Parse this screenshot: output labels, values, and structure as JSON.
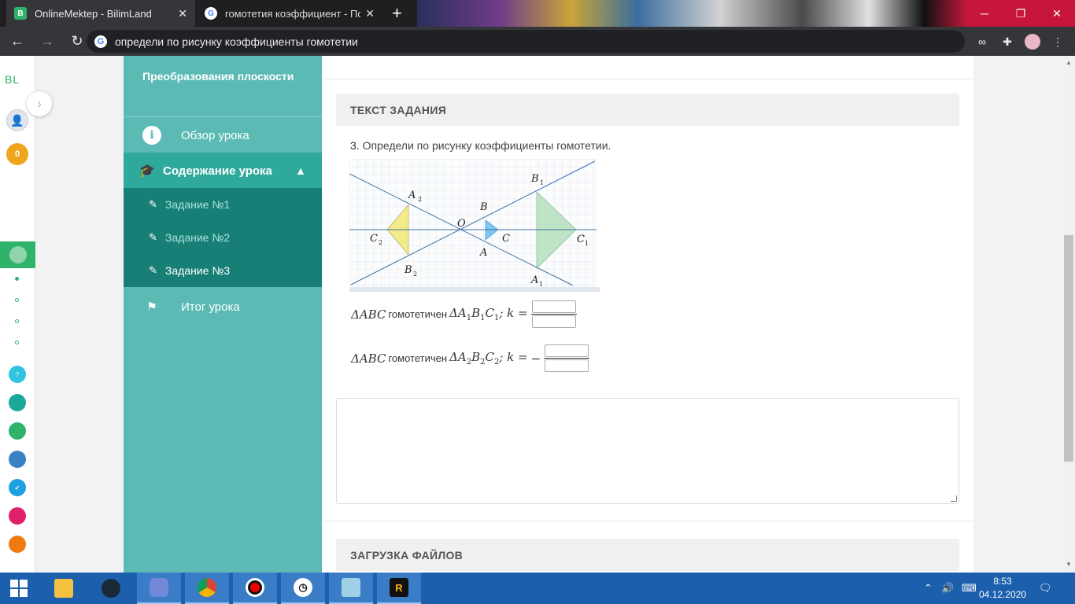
{
  "browser": {
    "tabs": [
      {
        "title": "OnlineMektep - BilimLand",
        "favicon": "bilimland-icon",
        "active": true
      },
      {
        "title": "гомотетия коэффициент - Поиск",
        "favicon": "google-icon",
        "active": false
      }
    ],
    "address": "определи по рисунку коэффициенты гомотетии"
  },
  "rail": {
    "logo": "BL",
    "coins": "0"
  },
  "lesson": {
    "title": "Преобразования плоскости",
    "overview": "Обзор урока",
    "content": "Содержание урока",
    "tasks": [
      "Задание №1",
      "Задание №2",
      "Задание №3"
    ],
    "summary": "Итог урока"
  },
  "main": {
    "task_header": "ТЕКСТ ЗАДАНИЯ",
    "task_number": "3.",
    "task_text": "Определи по рисунку коэффициенты гомотетии.",
    "figure_labels": {
      "A2": "A",
      "B1": "B",
      "O": "O",
      "B": "B",
      "C2": "C",
      "C": "C",
      "C1": "C",
      "A": "A",
      "B2": "B",
      "A1": "A",
      "s1": "1",
      "s2": "2"
    },
    "eq1": {
      "left": "ΔABC",
      "word": "гомотетичен",
      "right_1": "ΔA",
      "right_1s": "1",
      "right_2": "B",
      "right_2s": "1",
      "right_3": "C",
      "right_3s": "1",
      "k": "; k ="
    },
    "eq2": {
      "left": "ΔABC",
      "word": "гомотетичен",
      "right_1": "ΔA",
      "right_1s": "2",
      "right_2": "B",
      "right_2s": "2",
      "right_3": "C",
      "right_3s": "2",
      "k": "; k =",
      "sign": "−"
    },
    "upload_header": "ЗАГРУЗКА ФАЙЛОВ"
  },
  "taskbar": {
    "time": "8:53",
    "date": "04.12.2020"
  },
  "colors": {
    "sidebar": "#5bbab4",
    "sidebar_active": "#2fa99c",
    "submenu": "#177f76",
    "brand_green": "#2fb36a",
    "taskbar": "#1b5fad"
  }
}
